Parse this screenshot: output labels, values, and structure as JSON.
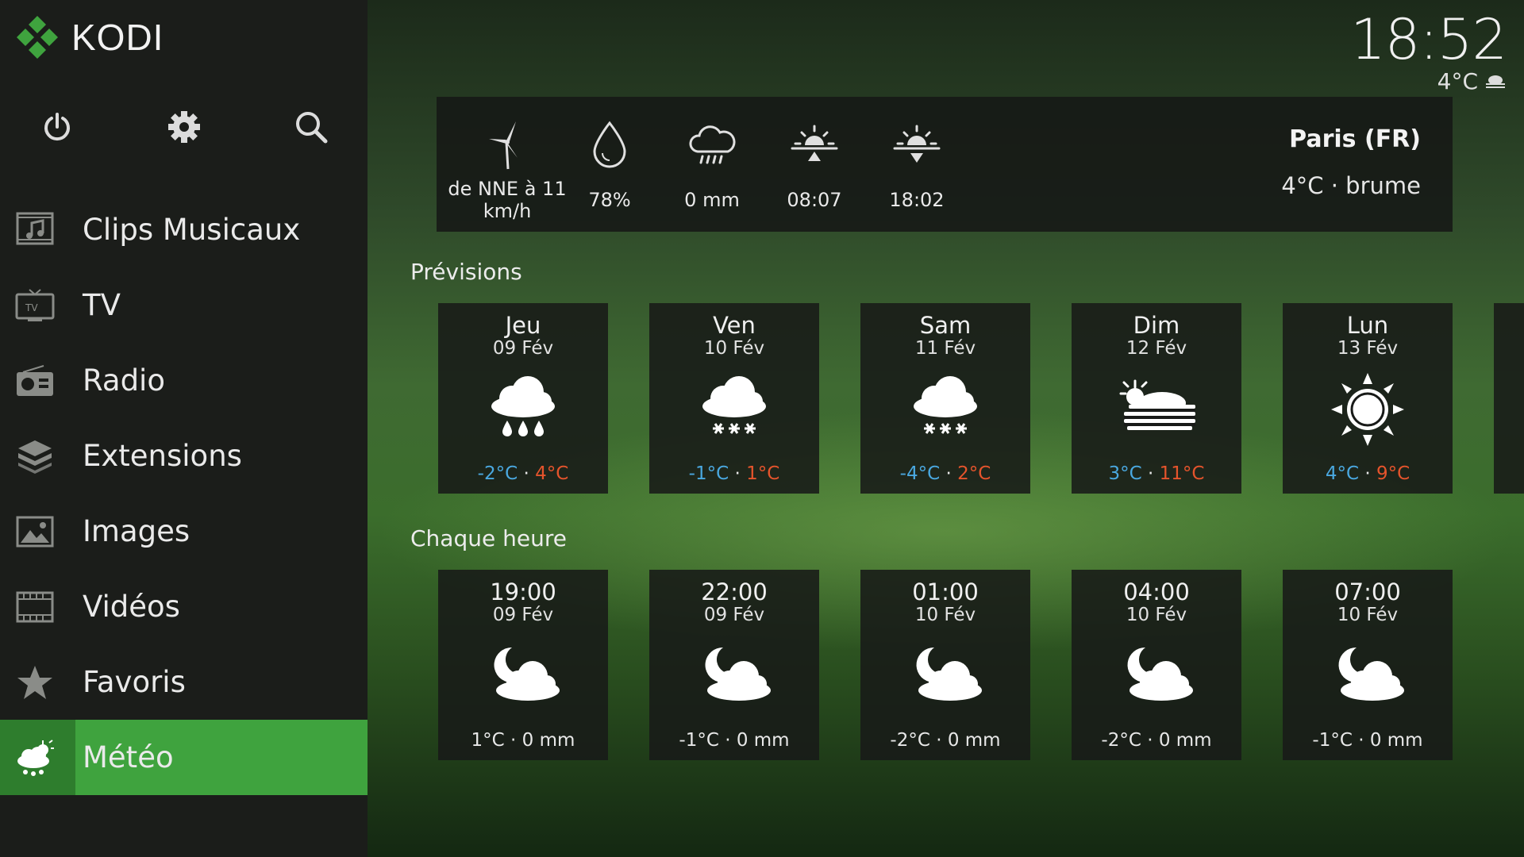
{
  "app": {
    "name": "KODI"
  },
  "clock": {
    "time": "18:52",
    "temp": "4°C"
  },
  "top_icons": [
    {
      "name": "power-icon"
    },
    {
      "name": "gear-icon"
    },
    {
      "name": "search-icon"
    }
  ],
  "nav": [
    {
      "label": "Clips Musicaux",
      "icon": "music-video-icon"
    },
    {
      "label": "TV",
      "icon": "tv-icon"
    },
    {
      "label": "Radio",
      "icon": "radio-icon"
    },
    {
      "label": "Extensions",
      "icon": "extensions-icon"
    },
    {
      "label": "Images",
      "icon": "images-icon"
    },
    {
      "label": "Vidéos",
      "icon": "videos-icon"
    },
    {
      "label": "Favoris",
      "icon": "star-icon"
    },
    {
      "label": "Météo",
      "icon": "weather-icon",
      "active": true
    }
  ],
  "current": {
    "stats": [
      {
        "icon": "wind-turbine-icon",
        "value": "de NNE à 11\nkm/h"
      },
      {
        "icon": "humidity-drop-icon",
        "value": "78%"
      },
      {
        "icon": "rain-cloud-icon",
        "value": "0 mm"
      },
      {
        "icon": "sunrise-icon",
        "value": "08:07"
      },
      {
        "icon": "sunset-icon",
        "value": "18:02"
      }
    ],
    "location": "Paris (FR)",
    "condition": "4°C · brume"
  },
  "forecast": {
    "title": "Prévisions",
    "days": [
      {
        "day": "Jeu",
        "date": "09 Fév",
        "icon": "rain-icon",
        "low": "-2°C",
        "high": "4°C"
      },
      {
        "day": "Ven",
        "date": "10 Fév",
        "icon": "snow-icon",
        "low": "-1°C",
        "high": "1°C"
      },
      {
        "day": "Sam",
        "date": "11 Fév",
        "icon": "snow-icon",
        "low": "-4°C",
        "high": "2°C"
      },
      {
        "day": "Dim",
        "date": "12 Fév",
        "icon": "sun-fog-icon",
        "low": "3°C",
        "high": "11°C"
      },
      {
        "day": "Lun",
        "date": "13 Fév",
        "icon": "sun-icon",
        "low": "4°C",
        "high": "9°C"
      }
    ]
  },
  "hourly": {
    "title": "Chaque heure",
    "hours": [
      {
        "time": "19:00",
        "date": "09 Fév",
        "icon": "moon-cloud-icon",
        "summary": "1°C · 0 mm"
      },
      {
        "time": "22:00",
        "date": "09 Fév",
        "icon": "moon-cloud-icon",
        "summary": "-1°C · 0 mm"
      },
      {
        "time": "01:00",
        "date": "10 Fév",
        "icon": "moon-cloud-icon",
        "summary": "-2°C · 0 mm"
      },
      {
        "time": "04:00",
        "date": "10 Fév",
        "icon": "moon-cloud-icon",
        "summary": "-2°C · 0 mm"
      },
      {
        "time": "07:00",
        "date": "10 Fév",
        "icon": "moon-cloud-icon",
        "summary": "-1°C · 0 mm"
      }
    ]
  },
  "colors": {
    "accent": "#3fa33e",
    "low_temp": "#4aa8e0",
    "high_temp": "#e5542c"
  }
}
